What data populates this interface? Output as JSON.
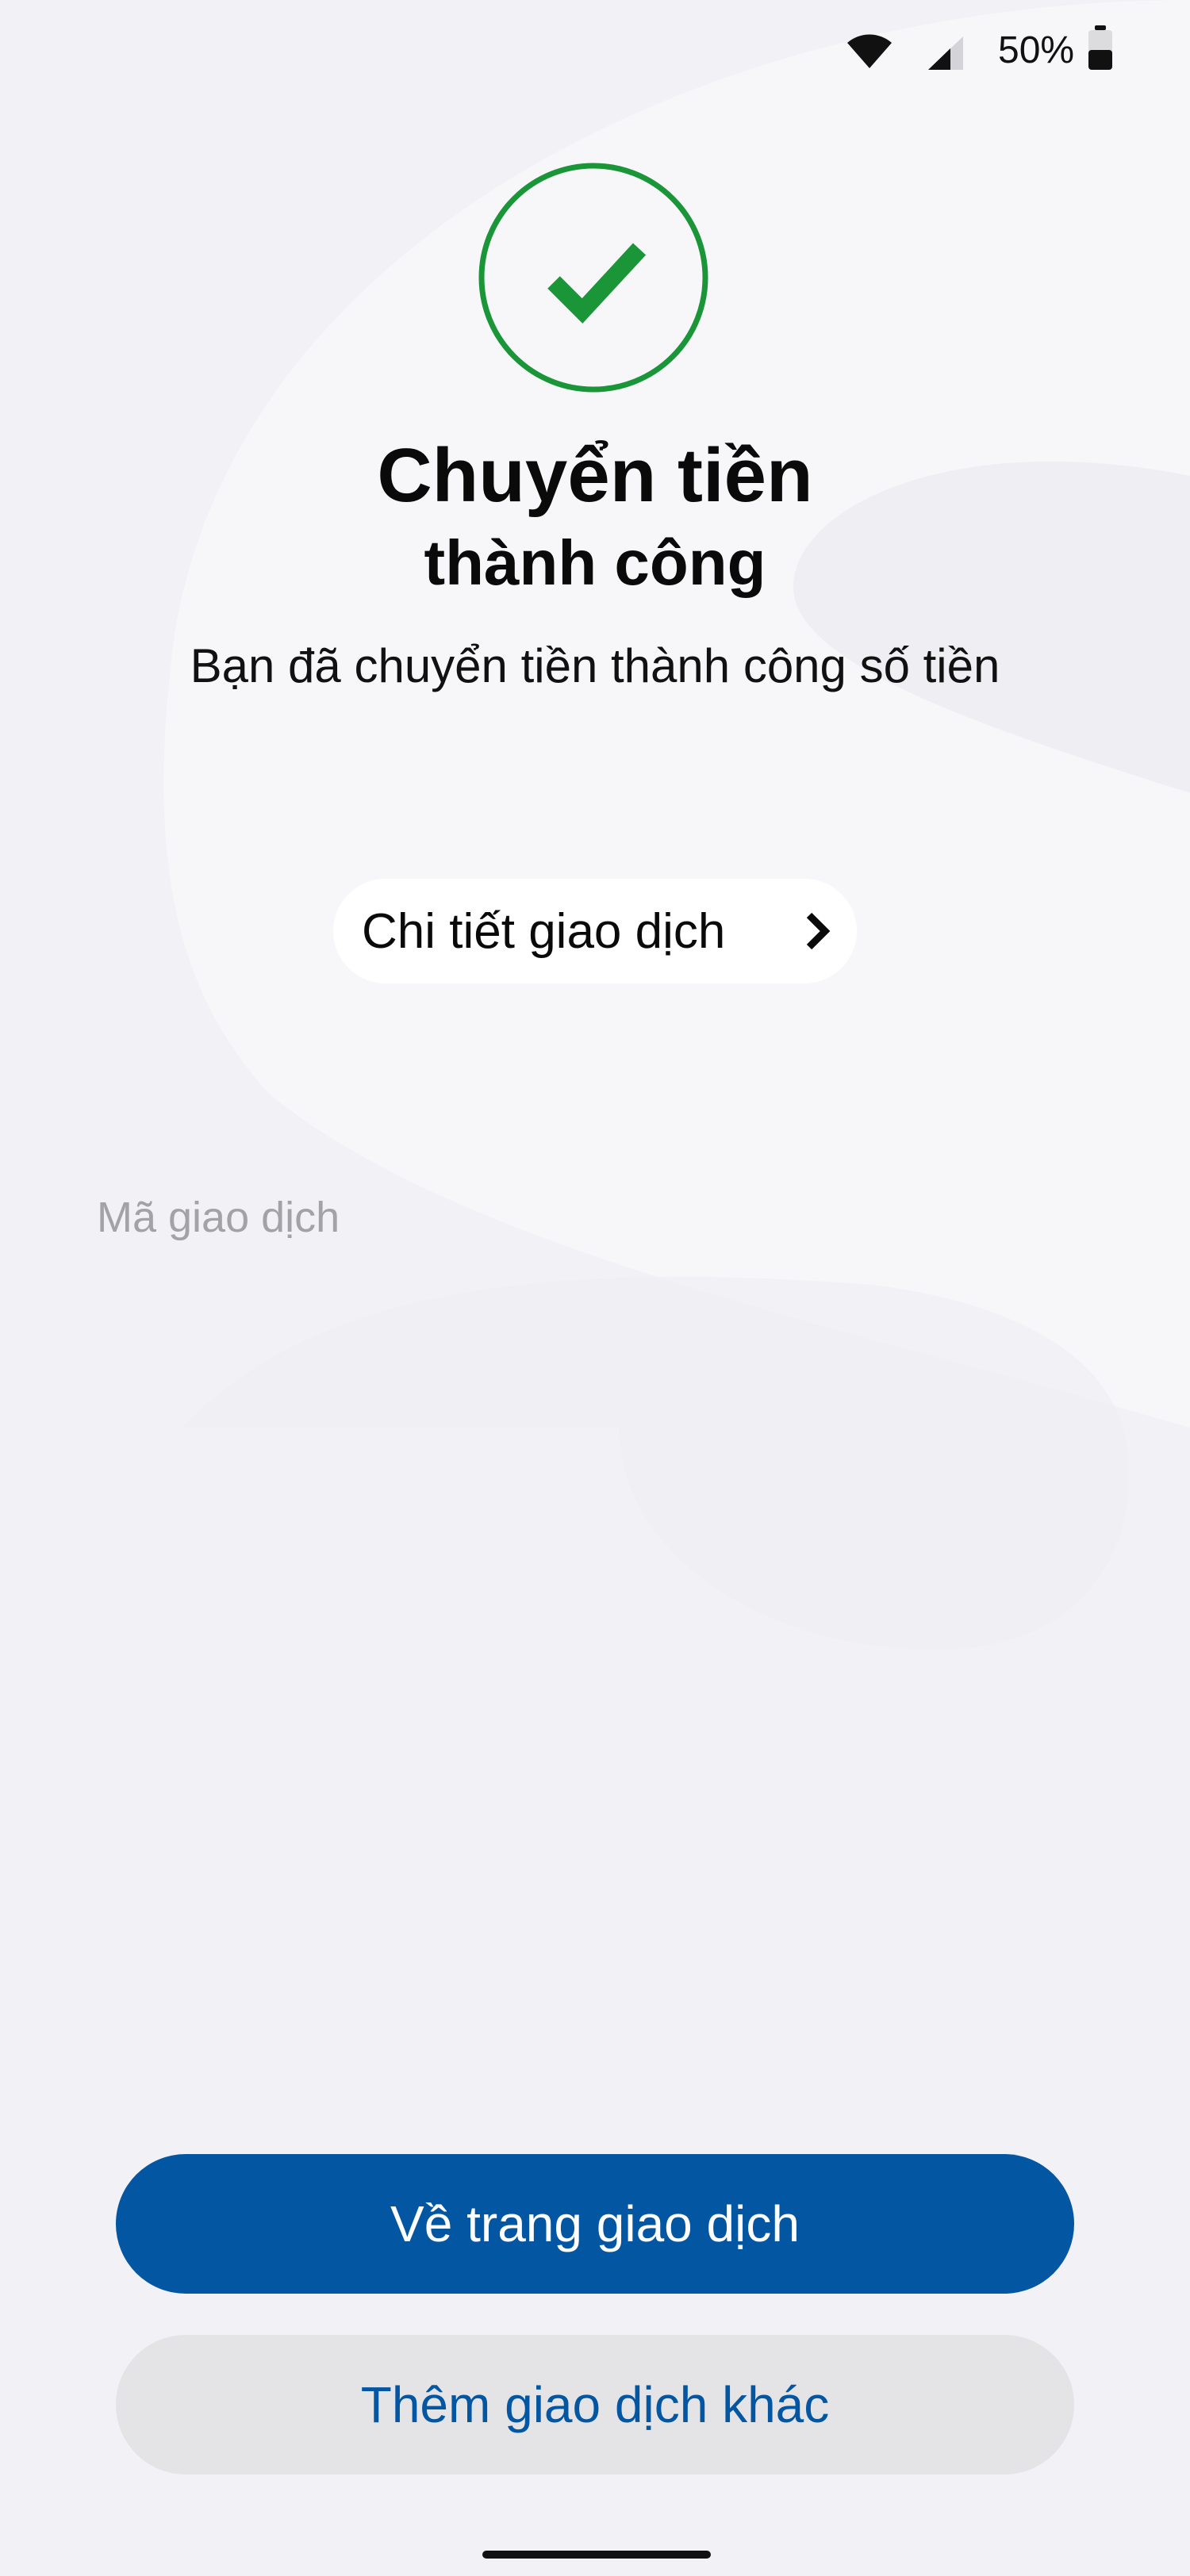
{
  "status_bar": {
    "battery_percent": "50%",
    "battery_level": 0.5,
    "wifi_icon": "wifi-icon",
    "signal_icon": "cellular-signal-icon",
    "battery_icon": "battery-icon"
  },
  "success": {
    "icon": "check-circle-icon",
    "color": "#1a9639",
    "title": "Chuyển tiền",
    "subtitle": "thành công",
    "message": "Bạn đã chuyển tiền thành công số tiền"
  },
  "details": {
    "label": "Chi tiết giao dịch",
    "icon": "chevron-right-icon"
  },
  "transaction": {
    "code_label": "Mã giao dịch"
  },
  "actions": {
    "primary_label": "Về trang giao dịch",
    "secondary_label": "Thêm giao dịch khác",
    "accent_color": "#0356a2"
  }
}
